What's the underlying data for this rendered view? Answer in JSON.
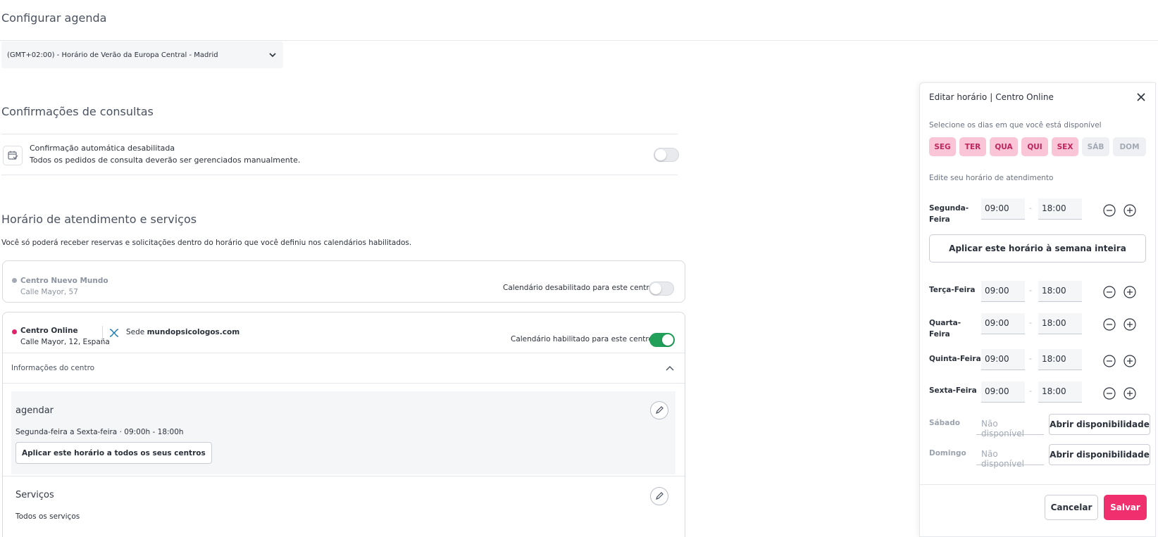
{
  "page": {
    "title": "Configurar agenda"
  },
  "timezone": {
    "selected": "(GMT+02:00) - Horário de Verão da Europa Central - Madrid"
  },
  "confirmations": {
    "heading": "Confirmações de consultas",
    "title": "Confirmação automática desabilitada",
    "description": "Todos os pedidos de consulta deverão ser gerenciados manualmente.",
    "enabled": false
  },
  "hours": {
    "heading": "Horário de atendimento e serviços",
    "hint": "Você só poderá receber reservas e solicitações dentro do horário que você definiu nos calendários habilitados."
  },
  "centers": [
    {
      "name": "Centro Nuevo Mundo",
      "address": "Calle Mayor, 57",
      "calendar_label": "Calendário desabilitado para este centro",
      "enabled": false,
      "dot_color": "#a3aab5"
    },
    {
      "name": "Centro Online",
      "address": "Calle Mayor, 12, España",
      "sede_prefix": "Sede",
      "sede_domain": "mundopsicologos.com",
      "calendar_label": "Calendário habilitado para este centro",
      "enabled": true,
      "dot_color": "#e0246b",
      "info_label": "Informações do centro",
      "schedule_title": "agendar",
      "schedule_days": "Segunda-feira a Sexta-feira ·",
      "schedule_hours": "09:00h - 18:00h",
      "apply_all_label": "Aplicar este horário a todos os seus centros",
      "services_title": "Serviços",
      "services_desc": "Todos os serviços"
    }
  ],
  "panel": {
    "title": "Editar horário",
    "separator": "|",
    "center": "Centro Online",
    "days_label": "Selecione os dias em que você está disponível",
    "days": [
      {
        "label": "SEG",
        "active": true
      },
      {
        "label": "TER",
        "active": true
      },
      {
        "label": "QUA",
        "active": true
      },
      {
        "label": "QUI",
        "active": true
      },
      {
        "label": "SEX",
        "active": true
      },
      {
        "label": "SÁB",
        "active": false
      },
      {
        "label": "DOM",
        "active": false
      }
    ],
    "edit_label": "Edite seu horário de atendimento",
    "rows": [
      {
        "day": "Segunda-Feira",
        "start": "09:00",
        "end": "18:00"
      },
      {
        "day": "Terça-Feira",
        "start": "09:00",
        "end": "18:00"
      },
      {
        "day": "Quarta-Feira",
        "start": "09:00",
        "end": "18:00"
      },
      {
        "day": "Quinta-Feira",
        "start": "09:00",
        "end": "18:00"
      },
      {
        "day": "Sexta-Feira",
        "start": "09:00",
        "end": "18:00"
      }
    ],
    "range_dash": "-",
    "apply_week_label": "Aplicar este horário à semana inteira",
    "unavailable": [
      {
        "day": "Sábado",
        "status": "Não disponível",
        "button": "Abrir disponibilidade"
      },
      {
        "day": "Domingo",
        "status": "Não disponível",
        "button": "Abrir disponibilidade"
      }
    ],
    "cancel_label": "Cancelar",
    "save_label": "Salvar"
  },
  "colors": {
    "accent": "#f0306e",
    "toggle_on": "#22a05a",
    "pill_active_bg": "#f9c5d7",
    "pill_active_text": "#c0255c"
  }
}
